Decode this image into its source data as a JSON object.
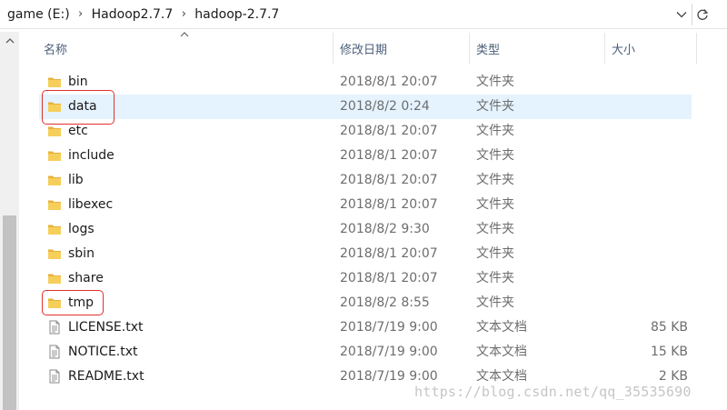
{
  "address_bar": {
    "breadcrumbs": [
      "game (E:)",
      "Hadoop2.7.7",
      "hadoop-2.7.7"
    ],
    "separator": "›",
    "dropdown_icon": "chevron-down-icon",
    "refresh_icon": "refresh-icon"
  },
  "columns": {
    "name": "名称",
    "date": "修改日期",
    "type": "类型",
    "size": "大小"
  },
  "files": [
    {
      "name": "bin",
      "date": "2018/8/1 20:07",
      "type": "文件夹",
      "size": "",
      "kind": "folder"
    },
    {
      "name": "data",
      "date": "2018/8/2 0:24",
      "type": "文件夹",
      "size": "",
      "kind": "folder",
      "selected": true
    },
    {
      "name": "etc",
      "date": "2018/8/1 20:07",
      "type": "文件夹",
      "size": "",
      "kind": "folder"
    },
    {
      "name": "include",
      "date": "2018/8/1 20:07",
      "type": "文件夹",
      "size": "",
      "kind": "folder"
    },
    {
      "name": "lib",
      "date": "2018/8/1 20:07",
      "type": "文件夹",
      "size": "",
      "kind": "folder"
    },
    {
      "name": "libexec",
      "date": "2018/8/1 20:07",
      "type": "文件夹",
      "size": "",
      "kind": "folder"
    },
    {
      "name": "logs",
      "date": "2018/8/2 9:30",
      "type": "文件夹",
      "size": "",
      "kind": "folder"
    },
    {
      "name": "sbin",
      "date": "2018/8/1 20:07",
      "type": "文件夹",
      "size": "",
      "kind": "folder"
    },
    {
      "name": "share",
      "date": "2018/8/1 20:07",
      "type": "文件夹",
      "size": "",
      "kind": "folder"
    },
    {
      "name": "tmp",
      "date": "2018/8/2 8:55",
      "type": "文件夹",
      "size": "",
      "kind": "folder"
    },
    {
      "name": "LICENSE.txt",
      "date": "2018/7/19 9:00",
      "type": "文本文档",
      "size": "85 KB",
      "kind": "text"
    },
    {
      "name": "NOTICE.txt",
      "date": "2018/7/19 9:00",
      "type": "文本文档",
      "size": "15 KB",
      "kind": "text"
    },
    {
      "name": "README.txt",
      "date": "2018/7/19 9:00",
      "type": "文本文档",
      "size": "2 KB",
      "kind": "text"
    }
  ],
  "watermark": "https://blog.csdn.net/qq_35535690",
  "colors": {
    "selection": "#e5f3ff",
    "folder": "#f3c74f",
    "annotation": "#e03030",
    "header_text": "#4c607a"
  }
}
